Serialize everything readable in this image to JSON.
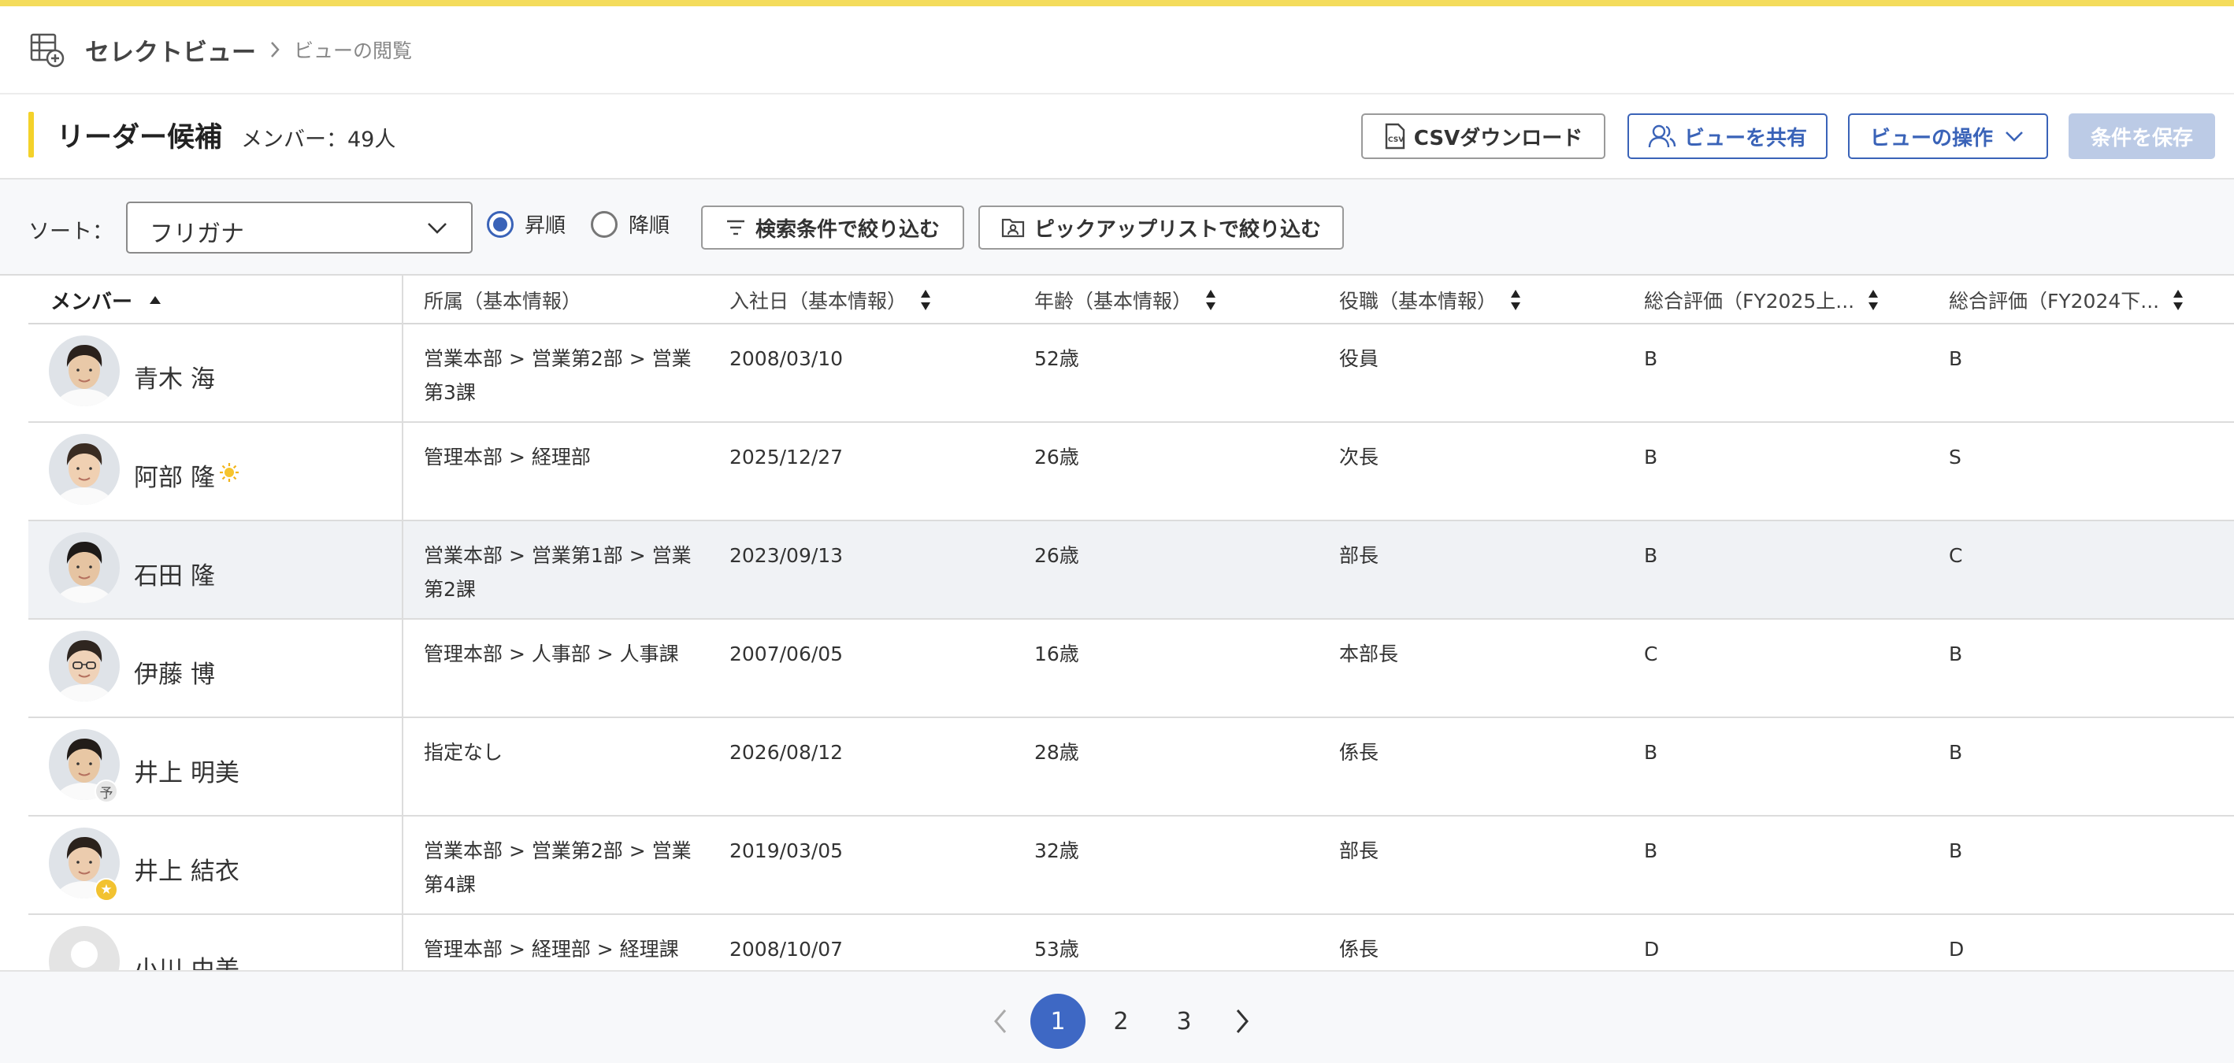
{
  "colors": {
    "accent": "#f4d22a",
    "primary": "#3a63b8",
    "active_page": "#3e68c4"
  },
  "breadcrumb": {
    "app": "セレクトビュー",
    "current": "ビューの閲覧"
  },
  "header": {
    "title": "リーダー候補",
    "member_count": "メンバー：49人",
    "csv_button": "CSVダウンロード",
    "share_button": "ビューを共有",
    "ops_button": "ビューの操作",
    "save_button": "条件を保存"
  },
  "toolbar": {
    "sort_label": "ソート：",
    "sort_value": "フリガナ",
    "asc_label": "昇順",
    "desc_label": "降順",
    "asc_selected": true,
    "filter_conditions": "検索条件で絞り込む",
    "filter_picklist": "ピックアップリストで絞り込む"
  },
  "table": {
    "columns": [
      "メンバー",
      "所属（基本情報）",
      "入社日（基本情報）",
      "年齢（基本情報）",
      "役職（基本情報）",
      "総合評価（FY2025上...",
      "総合評価（FY2024下..."
    ],
    "rows": [
      {
        "name": "青木 海",
        "dept": "営業本部 > 営業第2部 > 営業第3課",
        "date": "2008/03/10",
        "age": "52歳",
        "position": "役員",
        "eval1": "B",
        "eval2": "B",
        "badge": ""
      },
      {
        "name": "阿部 隆",
        "dept": "管理本部 > 経理部",
        "date": "2025/12/27",
        "age": "26歳",
        "position": "次長",
        "eval1": "B",
        "eval2": "S",
        "badge": "sun"
      },
      {
        "name": "石田 隆",
        "dept": "営業本部 > 営業第1部 > 営業第2課",
        "date": "2023/09/13",
        "age": "26歳",
        "position": "部長",
        "eval1": "B",
        "eval2": "C",
        "badge": ""
      },
      {
        "name": "伊藤 博",
        "dept": "管理本部 > 人事部 > 人事課",
        "date": "2007/06/05",
        "age": "16歳",
        "position": "本部長",
        "eval1": "C",
        "eval2": "B",
        "badge": ""
      },
      {
        "name": "井上 明美",
        "dept": "指定なし",
        "date": "2026/08/12",
        "age": "28歳",
        "position": "係長",
        "eval1": "B",
        "eval2": "B",
        "badge": "予"
      },
      {
        "name": "井上 結衣",
        "dept": "営業本部 > 営業第2部 > 営業第4課",
        "date": "2019/03/05",
        "age": "32歳",
        "position": "部長",
        "eval1": "B",
        "eval2": "B",
        "badge": "star"
      },
      {
        "name": "小川 由美",
        "dept": "管理本部 > 経理部 > 経理課",
        "date": "2008/10/07",
        "age": "53歳",
        "position": "係長",
        "eval1": "D",
        "eval2": "D",
        "badge": ""
      }
    ]
  },
  "pagination": {
    "pages": [
      "1",
      "2",
      "3"
    ],
    "current": "1"
  }
}
